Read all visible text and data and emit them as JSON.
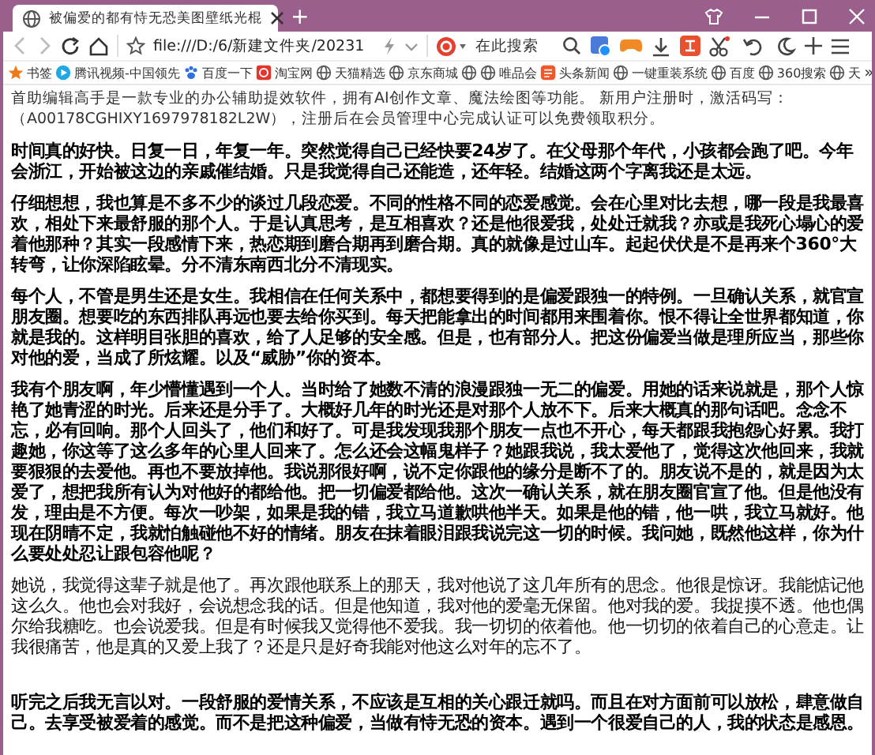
{
  "window": {
    "tab_title": "被偏爱的都有恃无恐美图壁纸光棍",
    "new_tab": "+"
  },
  "toolbar": {
    "address": "file:///D:/6/新建文件夹/20231",
    "search_placeholder": "在此搜索"
  },
  "bookmarks": [
    {
      "kind": "star",
      "label": "书签"
    },
    {
      "kind": "play",
      "label": "腾讯视频-中国领先"
    },
    {
      "kind": "paw",
      "label": "百度一下"
    },
    {
      "kind": "taobao",
      "label": "淘宝网"
    },
    {
      "kind": "globe",
      "label": "天猫精选"
    },
    {
      "kind": "globe",
      "label": "京东商城"
    },
    {
      "kind": "globe"
    },
    {
      "kind": "globe",
      "label": "唯品会"
    },
    {
      "kind": "news",
      "label": "头条新闻"
    },
    {
      "kind": "globe",
      "label": "一键重装系统"
    },
    {
      "kind": "globe",
      "label": "百度"
    },
    {
      "kind": "globe",
      "label": "360搜索"
    },
    {
      "kind": "globe",
      "label": "天"
    },
    {
      "kind": "more",
      "label": "»"
    }
  ],
  "notice": "首助编辑高手是一款专业的办公辅助提效软件，拥有AI创作文章、魔法绘图等功能。 新用户注册时，激活码写：（A00178CGHIXY1697978182L2W），注册后在会员管理中心完成认证可以免费领取积分。",
  "paragraphs": [
    {
      "bold": true,
      "spaced": false,
      "text": "时间真的好快。日复一日，年复一年。突然觉得自己已经快要24岁了。在父母那个年代，小孩都会跑了吧。今年会浙江，开始被这边的亲戚催结婚。只是我觉得自己还能造，还年轻。结婚这两个字离我还是太远。"
    },
    {
      "bold": true,
      "spaced": false,
      "text": "仔细想想，我也算是不多不少的谈过几段恋爱。不同的性格不同的恋爱感觉。会在心里对比去想，哪一段是我最喜欢，相处下来最舒服的那个人。于是认真思考，是互相喜欢？还是他很爱我，处处迁就我？亦或是我死心塌心的爱着他那种？其实一段感情下来，热恋期到磨合期再到磨合期。真的就像是过山车。起起伏伏是不是再来个360°大转弯，让你深陷眩晕。分不清东南西北分不清现实。"
    },
    {
      "bold": true,
      "spaced": false,
      "text": "每个人，不管是男生还是女生。我相信在任何关系中，都想要得到的是偏爱跟独一的特例。一旦确认关系，就官宣朋友圈。想要吃的东西排队再远也要去给你买到。每天把能拿出的时间都用来围着你。恨不得让全世界都知道，你就是我的。这样明目张胆的喜欢，给了人足够的安全感。但是，也有部分人。把这份偏爱当做是理所应当，那些你对他的爱，当成了所炫耀。以及“威胁”你的资本。"
    },
    {
      "bold": true,
      "spaced": false,
      "text": "我有个朋友啊，年少懵懂遇到一个人。当时给了她数不清的浪漫跟独一无二的偏爱。用她的话来说就是，那个人惊艳了她青涩的时光。后来还是分手了。大概好几年的时光还是对那个人放不下。后来大概真的那句话吧。念念不忘，必有回响。那个人回头了，他们和好了。可是我发现我那个朋友一点也不开心，每天都跟我抱怨心好累。我打趣她，你这等了这么多年的心里人回来了。怎么还会这幅鬼样子？她跟我说，我太爱他了，觉得这次他回来，我就要狠狠的去爱他。再也不要放掉他。我说那很好啊，说不定你跟他的缘分是断不了的。朋友说不是的，就是因为太爱了，想把我所有认为对他好的都给他。把一切偏爱都给他。这次一确认关系，就在朋友圈官宣了他。但是他没有发，理由是不方便。每次一吵架，如果是我的错，我立马道歉哄他半天。如果是他的错，他一哄，我立马就好。他现在阴晴不定，我就怕触碰他不好的情绪。朋友在抹着眼泪跟我说完这一切的时候。我问她，既然他这样，你为什么要处处忍让跟包容他呢？"
    },
    {
      "bold": false,
      "spaced": false,
      "text": "她说，我觉得这辈子就是他了。再次跟他联系上的那天，我对他说了这几年所有的思念。他很是惊讶。我能惦记他这么久。他也会对我好，会说想念我的话。但是他知道，我对他的爱毫无保留。他对我的爱。我捉摸不透。他也偶尔给我糖吃。也会说爱我。但是有时候我又觉得他不爱我。我一切切的依着他。他一切切的依着自己的心意走。让我很痛苦，他是真的又爱上我了？还是只是好奇我能对他这么对年的忘不了。"
    },
    {
      "bold": true,
      "spaced": true,
      "text": "听完之后我无言以对。一段舒服的爱情关系，不应该是互相的关心跟迁就吗。而且在对方面前可以放松，肆意做自己。去享受被爱着的感觉。而不是把这种偏爱，当做有恃无恐的资本。遇到一个很爱自己的人，我的状态是感恩。"
    }
  ]
}
